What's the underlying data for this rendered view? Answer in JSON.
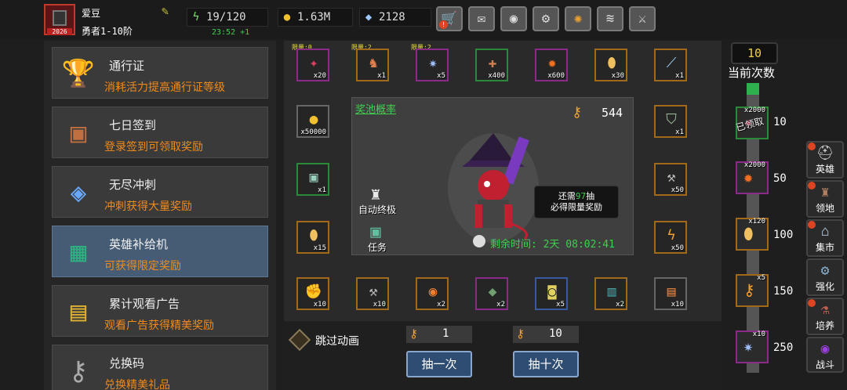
{
  "player": {
    "name": "爱豆",
    "rank": "勇者1-10阶",
    "avatar_level": "2026",
    "energy": "19/120",
    "energy_timer": "23:52 +1",
    "gold": "1.63M",
    "gems": "2128"
  },
  "top_icons": [
    "shop-cart-icon",
    "mail-icon",
    "gamepad-icon",
    "gear-icon",
    "color-wheel-icon",
    "wings-icon",
    "swords-icon"
  ],
  "left_menu": [
    {
      "title": "通行证",
      "desc": "消耗活力提高通行证等级",
      "icon": "chalice-icon"
    },
    {
      "title": "七日签到",
      "desc": "登录签到可领取奖励",
      "icon": "chest-icon"
    },
    {
      "title": "无尽冲刺",
      "desc": "冲刺获得大量奖励",
      "icon": "crystal-icon"
    },
    {
      "title": "英雄补给机",
      "desc": "可获得限定奖励",
      "icon": "supply-machine-icon",
      "selected": true
    },
    {
      "title": "累计观看广告",
      "desc": "观看广告获得精美奖励",
      "icon": "gold-chest-icon"
    },
    {
      "title": "兑换码",
      "desc": "兑换精美礼品",
      "icon": "key-icon"
    }
  ],
  "pool_items_top": [
    {
      "qty": "x20",
      "limit": "限量:0",
      "color": "purple",
      "icon": "claw-icon"
    },
    {
      "qty": "x1",
      "limit": "限量:2",
      "color": "orange",
      "icon": "fox-icon"
    },
    {
      "qty": "x5",
      "limit": "限量:2",
      "color": "purple",
      "icon": "star-icon"
    },
    {
      "qty": "x400",
      "color": "green",
      "icon": "bone-icon"
    },
    {
      "qty": "x600",
      "color": "purple",
      "icon": "fire-claw-icon"
    },
    {
      "qty": "x30",
      "color": "orange",
      "icon": "egg-icon"
    },
    {
      "qty": "x1",
      "color": "orange",
      "icon": "quill-icon"
    }
  ],
  "pool_items_side": [
    {
      "qty": "x50000",
      "color": "gray",
      "icon": "coin-icon"
    },
    {
      "qty": "x1",
      "color": "green",
      "icon": "treasure-chest-icon"
    },
    {
      "qty": "x15",
      "color": "orange",
      "icon": "egg-icon"
    },
    {
      "qty": "x1",
      "color": "orange",
      "icon": "shield-icon"
    },
    {
      "qty": "x50",
      "color": "orange",
      "icon": "hammer-icon"
    },
    {
      "qty": "x50",
      "color": "orange",
      "icon": "lightning-icon"
    }
  ],
  "pool_items_bottom": [
    {
      "qty": "x10",
      "color": "orange",
      "icon": "gauntlet-icon"
    },
    {
      "qty": "x10",
      "color": "orange",
      "icon": "mace-icon"
    },
    {
      "qty": "x2",
      "color": "orange",
      "icon": "medal-icon"
    },
    {
      "qty": "x2",
      "color": "purple",
      "icon": "gem-icon"
    },
    {
      "qty": "x5",
      "color": "blue",
      "icon": "rune-icon"
    },
    {
      "qty": "x2",
      "color": "orange",
      "icon": "book-icon"
    },
    {
      "qty": "x10",
      "color": "gray",
      "icon": "scroll-icon"
    }
  ],
  "center": {
    "pool_link": "奖池概率",
    "key_count": "544",
    "bubble_line1_pre": "还需",
    "bubble_line1_num": "97",
    "bubble_line1_post": "抽",
    "bubble_line2": "必得限量奖励",
    "auto_upgrade": "自动终极",
    "task": "任务",
    "timer": "剩余时间: 2天  08:02:41"
  },
  "bottom": {
    "skip_label": "跳过动画",
    "cost_single": "1",
    "cost_ten": "10",
    "draw_one": "抽一次",
    "draw_ten": "抽十次"
  },
  "progress": {
    "count": "10",
    "count_label": "当前次数",
    "fraction": 0.04,
    "milestones": [
      {
        "value": "10",
        "qty": "x2000",
        "claimed": true,
        "stamp": "已领取",
        "icon": "claw-icon"
      },
      {
        "value": "50",
        "qty": "x2000",
        "icon": "fire-claw-icon"
      },
      {
        "value": "100",
        "qty": "x120",
        "icon": "egg-icon"
      },
      {
        "value": "150",
        "qty": "x5",
        "icon": "key-icon"
      },
      {
        "value": "250",
        "qty": "x10",
        "icon": "star-icon"
      }
    ]
  },
  "right_nav": [
    {
      "label": "英雄",
      "icon": "helmet-icon"
    },
    {
      "label": "领地",
      "icon": "castle-icon"
    },
    {
      "label": "集市",
      "icon": "market-icon"
    },
    {
      "label": "强化",
      "icon": "anvil-icon"
    },
    {
      "label": "培养",
      "icon": "potion-icon"
    },
    {
      "label": "战斗",
      "icon": "portal-icon"
    }
  ],
  "colors": {
    "accent_orange": "#f08a1a",
    "accent_green": "#3fd04f",
    "selected_card": "#465c75"
  }
}
